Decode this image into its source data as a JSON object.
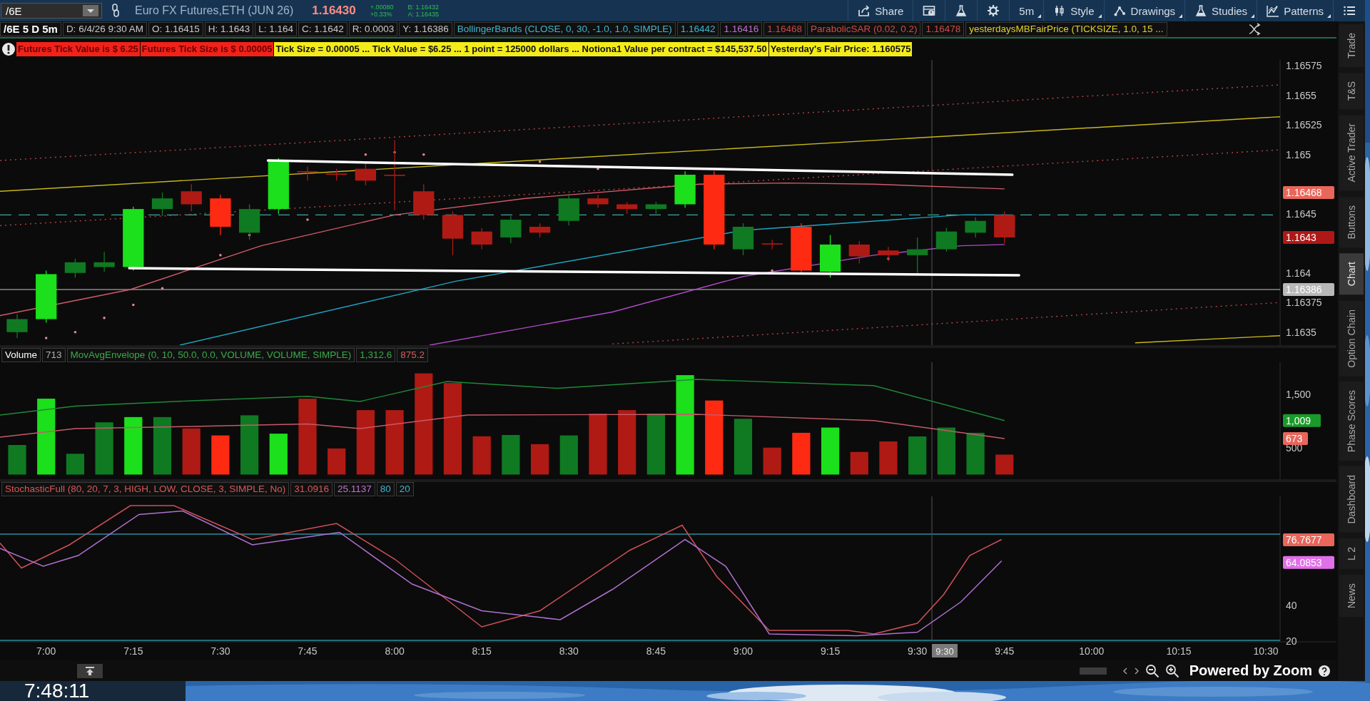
{
  "top_bar": {
    "symbol": "/6E",
    "description": "Euro FX Futures,ETH (JUN 26)",
    "last_price": "1.16430",
    "change": "+.00080",
    "change_percent": "+0.33%",
    "bid": "B: 1.16432",
    "ask": "A: 1.16435",
    "toolbar": [
      {
        "kind": "share",
        "label": "Share",
        "has_menu": false
      },
      {
        "kind": "notes",
        "has_menu": false
      },
      {
        "kind": "flask",
        "has_menu": false
      },
      {
        "kind": "gear",
        "has_menu": false
      },
      {
        "kind": "text",
        "label": "5m",
        "has_menu": true
      },
      {
        "kind": "style",
        "label": "Style",
        "has_menu": true
      },
      {
        "kind": "drawings",
        "label": "Drawings",
        "has_menu": true
      },
      {
        "kind": "flask",
        "label": "Studies",
        "has_menu": true
      },
      {
        "kind": "patterns",
        "label": "Patterns",
        "has_menu": true
      },
      {
        "kind": "list",
        "has_menu": false
      }
    ]
  },
  "info_row": [
    {
      "text": "/6E 5 D 5m",
      "color": "#ffffff"
    },
    {
      "text": "D: 6/4/26 9:30 AM",
      "color": "#c8c8c8"
    },
    {
      "text": "O: 1.16415",
      "color": "#c8c8c8"
    },
    {
      "text": "H: 1.1643",
      "color": "#c8c8c8"
    },
    {
      "text": "L: 1.164",
      "color": "#c8c8c8"
    },
    {
      "text": "C: 1.1642",
      "color": "#c8c8c8"
    },
    {
      "text": "R: 0.0003",
      "color": "#c8c8c8"
    },
    {
      "text": "Y: 1.16386",
      "color": "#c8c8c8"
    },
    {
      "text": "BollingerBands (CLOSE, 0, 30, -1.0, 1.0, SIMPLE)",
      "color": "#3fb7d0"
    },
    {
      "text": "1.16442",
      "color": "#3fb7d0"
    },
    {
      "text": "1.16416",
      "color": "#c070d0"
    },
    {
      "text": "1.16468",
      "color": "#c84848"
    },
    {
      "text": "ParabolicSAR (0.02, 0.2)",
      "color": "#d04a4a"
    },
    {
      "text": "1.16478",
      "color": "#d04a4a"
    },
    {
      "text": "yesterdaysMBFairPrice (TICKSIZE, 1.0, 15 ...",
      "color": "#e0d030"
    }
  ],
  "alerts": [
    {
      "kind": "alert",
      "text": "Futures Tick Value is $ 6.25"
    },
    {
      "kind": "alert",
      "text": "Futures Tick Size is $ 0.00005"
    },
    {
      "kind": "note",
      "text": "Tick Size =  0.00005 ... Tick Value =  $6.25 ... 1 point = 125000 dollars ... Notiona1 Value per contract =  $145,537.50"
    },
    {
      "kind": "note",
      "text": "Yesterday's Fair Price: 1.160575"
    }
  ],
  "price_panel": {
    "axis_labels": [
      "1.16575",
      "1.1655",
      "1.16525",
      "1.165",
      "1.1645",
      "1.164",
      "1.16375",
      "1.1635"
    ],
    "badges": [
      {
        "text": "1.16468",
        "color": "#e8665a"
      },
      {
        "text": "1.1643",
        "color": "#b01818"
      },
      {
        "text": "1.16386",
        "color": "#b8b8b8"
      }
    ]
  },
  "volume_panel": {
    "header": [
      {
        "text": "Volume",
        "color": "#ffffff"
      },
      {
        "text": "713",
        "color": "#b0b0b0"
      },
      {
        "text": "MovAvgEnvelope (0, 10, 50.0, 0.0, VOLUME, VOLUME, SIMPLE)",
        "color": "#3aaa4a"
      },
      {
        "text": "1,312.6",
        "color": "#3aaa4a"
      },
      {
        "text": "875.2",
        "color": "#d06060"
      }
    ],
    "axis_labels": [
      "1,500",
      "500"
    ],
    "badges": [
      {
        "text": "1,009",
        "color": "#1a9a2a"
      },
      {
        "text": "673",
        "color": "#e8665a"
      }
    ]
  },
  "stochastic_panel": {
    "header": [
      {
        "text": "StochasticFull (80, 20, 7, 3, HIGH, LOW, CLOSE, 3, SIMPLE, No)",
        "color": "#d85858"
      },
      {
        "text": "31.0916",
        "color": "#d85858"
      },
      {
        "text": "25.1137",
        "color": "#c070d0"
      },
      {
        "text": "80",
        "color": "#3fb7d0"
      },
      {
        "text": "20",
        "color": "#3fb7d0"
      }
    ],
    "axis_labels": [
      "40",
      "20"
    ],
    "badges": [
      {
        "text": "76.7677",
        "color": "#e8665a"
      },
      {
        "text": "64.0853",
        "color": "#e070e8"
      }
    ]
  },
  "time_axis": {
    "labels": [
      "7:00",
      "7:15",
      "7:30",
      "7:45",
      "8:00",
      "8:15",
      "8:30",
      "8:45",
      "9:00",
      "9:15",
      "9:30",
      "9:45",
      "10:00",
      "10:15",
      "10:30"
    ],
    "cursor": "9:30"
  },
  "side_tabs": [
    {
      "label": "Trade",
      "selected": false
    },
    {
      "label": "T&S",
      "selected": false
    },
    {
      "label": "Active Trader",
      "selected": false
    },
    {
      "label": "Buttons",
      "selected": false
    },
    {
      "label": "Chart",
      "selected": true
    },
    {
      "label": "Option Chain",
      "selected": false
    },
    {
      "label": "Phase Scores",
      "selected": false
    },
    {
      "label": "Dashboard",
      "selected": false
    },
    {
      "label": "L 2",
      "selected": false
    },
    {
      "label": "News",
      "selected": false
    }
  ],
  "bottom_bar": {
    "notice": "Powered by Zoom"
  },
  "clock": "7:48:11"
}
